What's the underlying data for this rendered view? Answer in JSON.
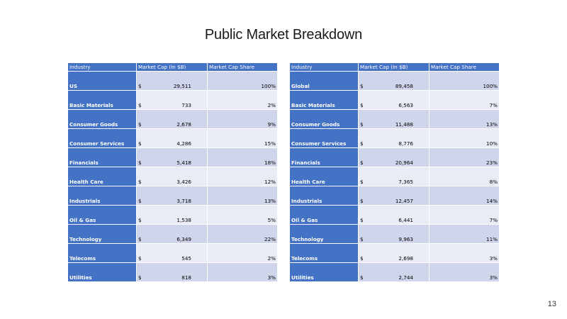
{
  "title": "Public Market Breakdown",
  "page_number": "13",
  "tables": [
    {
      "headers": [
        "Industry",
        "Market Cap (In $B)",
        "Market Cap Share"
      ],
      "rows": [
        {
          "industry": "US",
          "currency": "$",
          "value": "29,511",
          "share": "100%"
        },
        {
          "industry": "Basic Materials",
          "currency": "$",
          "value": "733",
          "share": "2%"
        },
        {
          "industry": "Consumer Goods",
          "currency": "$",
          "value": "2,678",
          "share": "9%"
        },
        {
          "industry": "Consumer Services",
          "currency": "$",
          "value": "4,286",
          "share": "15%"
        },
        {
          "industry": "Financials",
          "currency": "$",
          "value": "5,418",
          "share": "18%"
        },
        {
          "industry": "Health Care",
          "currency": "$",
          "value": "3,426",
          "share": "12%"
        },
        {
          "industry": "Industrials",
          "currency": "$",
          "value": "3,718",
          "share": "13%"
        },
        {
          "industry": "Oil & Gas",
          "currency": "$",
          "value": "1,538",
          "share": "5%"
        },
        {
          "industry": "Technology",
          "currency": "$",
          "value": "6,349",
          "share": "22%"
        },
        {
          "industry": "Telecoms",
          "currency": "$",
          "value": "545",
          "share": "2%"
        },
        {
          "industry": "Utilities",
          "currency": "$",
          "value": "818",
          "share": "3%"
        }
      ]
    },
    {
      "headers": [
        "Industry",
        "Market Cap (In $B)",
        "Market Cap Share"
      ],
      "rows": [
        {
          "industry": "Global",
          "currency": "$",
          "value": "89,458",
          "share": "100%"
        },
        {
          "industry": "Basic Materials",
          "currency": "$",
          "value": "6,563",
          "share": "7%"
        },
        {
          "industry": "Consumer Goods",
          "currency": "$",
          "value": "11,488",
          "share": "13%"
        },
        {
          "industry": "Consumer Services",
          "currency": "$",
          "value": "8,776",
          "share": "10%"
        },
        {
          "industry": "Financials",
          "currency": "$",
          "value": "20,964",
          "share": "23%"
        },
        {
          "industry": "Health Care",
          "currency": "$",
          "value": "7,365",
          "share": "8%"
        },
        {
          "industry": "Industrials",
          "currency": "$",
          "value": "12,457",
          "share": "14%"
        },
        {
          "industry": "Oil & Gas",
          "currency": "$",
          "value": "6,441",
          "share": "7%"
        },
        {
          "industry": "Technology",
          "currency": "$",
          "value": "9,963",
          "share": "11%"
        },
        {
          "industry": "Telecoms",
          "currency": "$",
          "value": "2,698",
          "share": "3%"
        },
        {
          "industry": "Utilities",
          "currency": "$",
          "value": "2,744",
          "share": "3%"
        }
      ]
    }
  ]
}
